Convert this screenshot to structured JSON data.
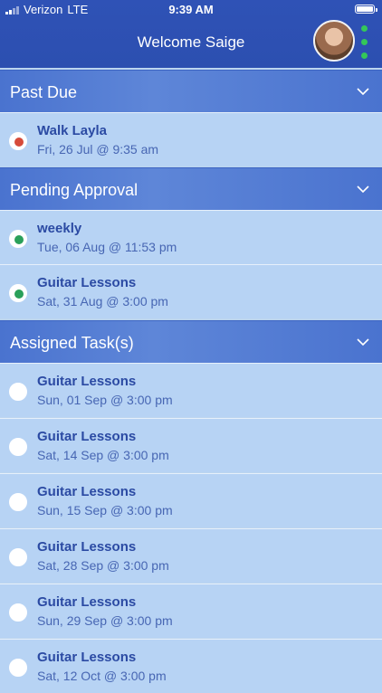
{
  "status": {
    "carrier": "Verizon",
    "network": "LTE",
    "time": "9:39 AM"
  },
  "header": {
    "title": "Welcome Saige"
  },
  "sections": [
    {
      "label": "Past Due"
    },
    {
      "label": "Pending Approval"
    },
    {
      "label": "Assigned Task(s)"
    }
  ],
  "items": [
    {
      "title": "Walk Layla",
      "subtitle": "Fri, 26 Jul @ 9:35 am",
      "dot": "#d64b3a"
    },
    {
      "title": "weekly",
      "subtitle": "Tue, 06 Aug @ 11:53 pm",
      "dot": "#2aa05a"
    },
    {
      "title": "Guitar Lessons",
      "subtitle": "Sat, 31 Aug @ 3:00 pm",
      "dot": "#2aa05a"
    },
    {
      "title": "Guitar Lessons",
      "subtitle": "Sun, 01 Sep @ 3:00 pm",
      "dot": ""
    },
    {
      "title": "Guitar Lessons",
      "subtitle": "Sat, 14 Sep @ 3:00 pm",
      "dot": ""
    },
    {
      "title": "Guitar Lessons",
      "subtitle": "Sun, 15 Sep @ 3:00 pm",
      "dot": ""
    },
    {
      "title": "Guitar Lessons",
      "subtitle": "Sat, 28 Sep @ 3:00 pm",
      "dot": ""
    },
    {
      "title": "Guitar Lessons",
      "subtitle": "Sun, 29 Sep @ 3:00 pm",
      "dot": ""
    },
    {
      "title": "Guitar Lessons",
      "subtitle": "Sat, 12 Oct @ 3:00 pm",
      "dot": ""
    }
  ]
}
